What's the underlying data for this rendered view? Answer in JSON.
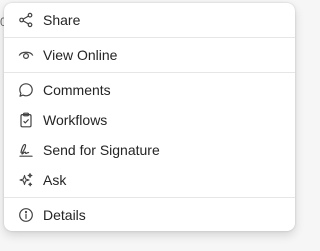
{
  "edge_text": "0",
  "menu": {
    "items": [
      {
        "label": "Share",
        "icon": "share-icon"
      },
      {
        "label": "View Online",
        "icon": "eye-icon"
      },
      {
        "label": "Comments",
        "icon": "comment-icon"
      },
      {
        "label": "Workflows",
        "icon": "clipboard-check-icon"
      },
      {
        "label": "Send for Signature",
        "icon": "signature-icon"
      },
      {
        "label": "Ask",
        "icon": "sparkle-icon"
      },
      {
        "label": "Details",
        "icon": "info-icon"
      }
    ]
  },
  "colors": {
    "text": "#242424",
    "icon": "#424242",
    "separator": "#e6e6e6",
    "menu_background": "#ffffff",
    "page_background": "#f6f6f6"
  }
}
